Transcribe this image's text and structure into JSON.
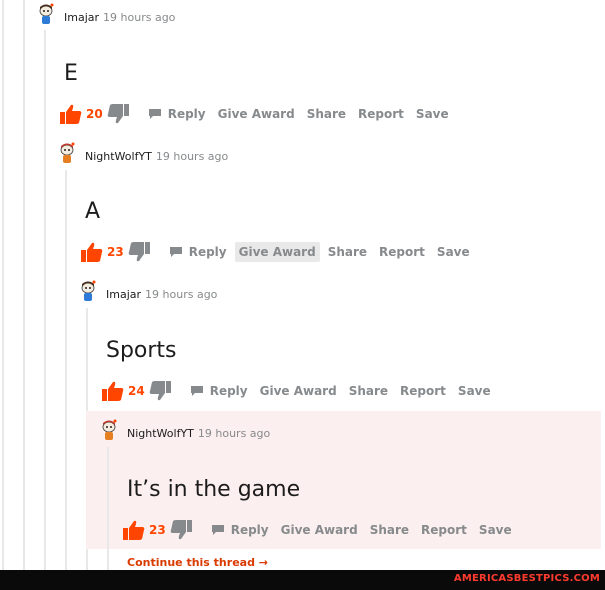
{
  "comments": [
    {
      "author": "Imajar",
      "time": "19 hours ago",
      "body": "E",
      "score": "20",
      "avatar_icon": "snoo-avatar-icon-blue"
    },
    {
      "author": "NightWolfYT",
      "time": "19 hours ago",
      "body": "A",
      "score": "23",
      "avatar_icon": "snoo-avatar-icon-orange"
    },
    {
      "author": "Imajar",
      "time": "19 hours ago",
      "body": "Sports",
      "score": "24",
      "avatar_icon": "snoo-avatar-icon-blue"
    },
    {
      "author": "NightWolfYT",
      "time": "19 hours ago",
      "body": "It’s in the game",
      "score": "23",
      "avatar_icon": "snoo-avatar-icon-orange"
    }
  ],
  "actions": {
    "reply": "Reply",
    "give_award": "Give Award",
    "share": "Share",
    "report": "Report",
    "save": "Save"
  },
  "continue_thread": "Continue this thread →",
  "watermark": "AMERICASBESTPICS.COM",
  "colors": {
    "upvote": "#ff4500",
    "muted": "#878a8c",
    "highlight": "#fcefef",
    "link": "#d93a00"
  }
}
